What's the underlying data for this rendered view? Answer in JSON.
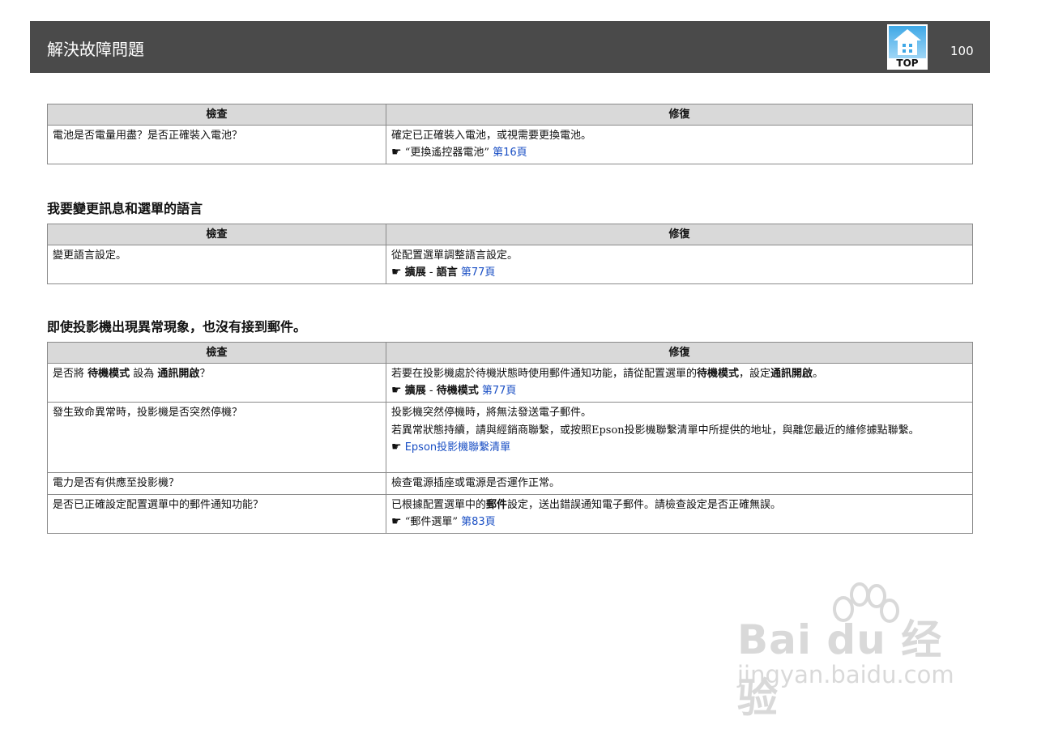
{
  "header": {
    "title": "解決故障問題",
    "page_number": "100",
    "top_label": "TOP"
  },
  "table1": {
    "col_check": "檢查",
    "col_fix": "修復",
    "rows": [
      {
        "check": "電池是否電量用盡？是否正確裝入電池？",
        "fix_line1": "確定已正確裝入電池，或視需要更換電池。",
        "ref_hand": "☛",
        "ref_text": "“更換遙控器電池”",
        "ref_link": "第16頁"
      }
    ]
  },
  "section2": {
    "title": "我要變更訊息和選單的語言"
  },
  "table2": {
    "col_check": "檢查",
    "col_fix": "修復",
    "rows": [
      {
        "check": "變更語言設定。",
        "fix_line1": "從配置選單調整語言設定。",
        "ref_hand": "☛",
        "ref_part1": "擴展",
        "ref_sep": " - ",
        "ref_part2": "語言",
        "ref_link": "第77頁"
      }
    ]
  },
  "section3": {
    "title": "即使投影機出現異常現象，也沒有接到郵件。"
  },
  "table3": {
    "col_check": "檢查",
    "col_fix": "修復",
    "row1": {
      "check_a": "是否將 ",
      "check_b": "待機模式",
      "check_c": " 設為 ",
      "check_d": "通訊開啟",
      "check_e": "？",
      "fix_a": "若要在投影機處於待機狀態時使用郵件通知功能，請從配置選單的",
      "fix_b": "待機模式",
      "fix_c": "，設定",
      "fix_d": "通訊開啟",
      "fix_e": "。",
      "ref_hand": "☛",
      "ref_part1": "擴展",
      "ref_sep": " - ",
      "ref_part2": "待機模式",
      "ref_link": "第77頁"
    },
    "row2": {
      "check": "發生致命異常時，投影機是否突然停機？",
      "fix_line1": "投影機突然停機時，將無法發送電子郵件。",
      "fix_line2": "若異常狀態持續，請與經銷商聯繫，或按照Epson投影機聯繫清單中所提供的地址，與離您最近的維修據點聯繫。",
      "ref_hand": "☛",
      "ref_link": "Epson投影機聯繫清單"
    },
    "row3": {
      "check": "電力是否有供應至投影機？",
      "fix_line1": "檢查電源插座或電源是否運作正常。"
    },
    "row4": {
      "check": "是否已正確設定配置選單中的郵件通知功能？",
      "fix_a": "已根據配置選單中的",
      "fix_b": "郵件",
      "fix_c": "設定，送出錯誤通知電子郵件。請檢查設定是否正確無誤。",
      "ref_hand": "☛",
      "ref_text": "“郵件選單”",
      "ref_link": "第83頁"
    }
  },
  "watermark": {
    "logo": "Bai du 经验",
    "url": "jingyan.baidu.com"
  }
}
